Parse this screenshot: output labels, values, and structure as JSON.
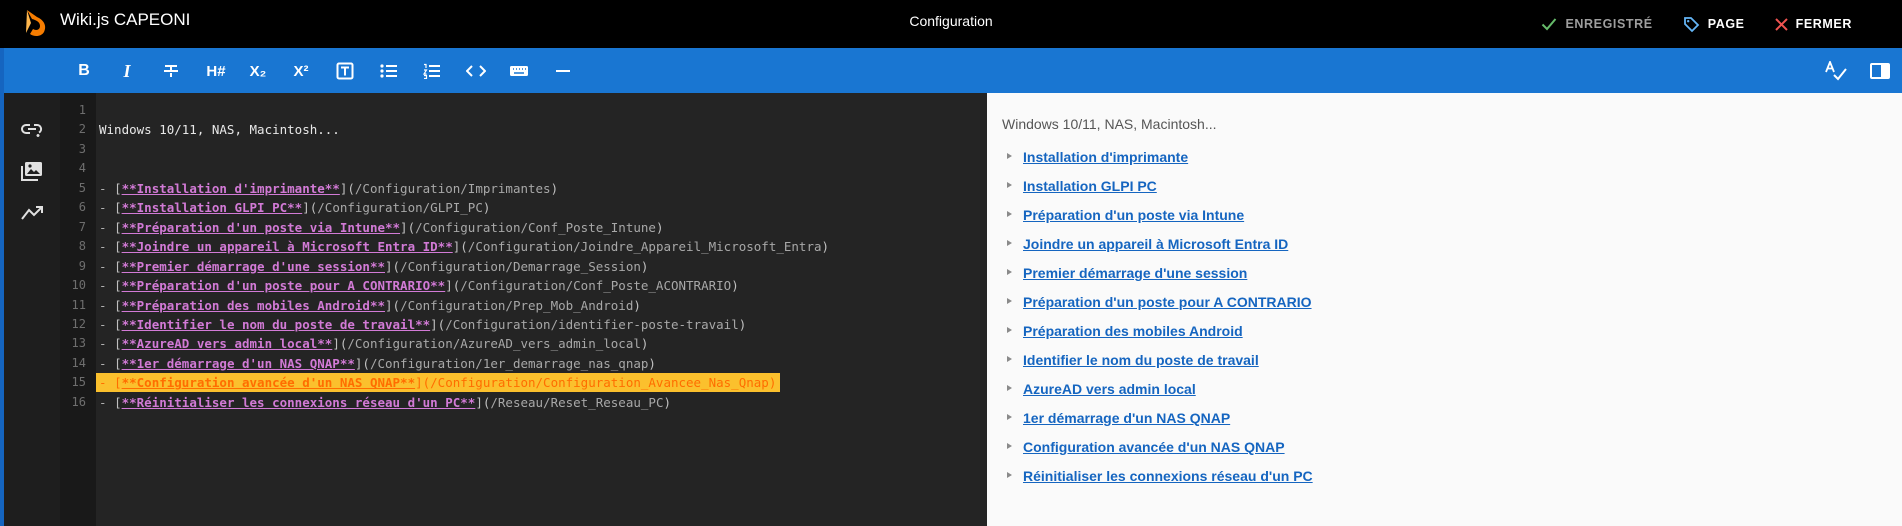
{
  "header": {
    "app_title": "Wiki.js CAPEONI",
    "page_title": "Configuration",
    "saved_label": "ENREGISTRÉ",
    "page_label": "PAGE",
    "close_label": "FERMER",
    "colors": {
      "saved": "#9e9e9e",
      "check": "#66bb6a",
      "tag": "#64b5f6",
      "close_x": "#ef5350",
      "logo": "#f57c00"
    }
  },
  "toolbar": {
    "accent": "#1976d2",
    "buttons": [
      {
        "name": "bold",
        "label": "B",
        "icon": "format-bold-icon"
      },
      {
        "name": "italic",
        "label": "I",
        "icon": "format-italic-icon"
      },
      {
        "name": "strikethrough",
        "icon": "strikethrough-icon"
      },
      {
        "name": "heading",
        "label": "H#",
        "icon": "heading-icon"
      },
      {
        "name": "subscript",
        "label": "X₂",
        "icon": "subscript-icon"
      },
      {
        "name": "superscript",
        "label": "X²",
        "icon": "superscript-icon"
      },
      {
        "name": "blockquote",
        "icon": "text-box-icon"
      },
      {
        "name": "unordered-list",
        "icon": "bullet-list-icon"
      },
      {
        "name": "ordered-list",
        "icon": "numbered-list-icon"
      },
      {
        "name": "inline-code",
        "icon": "code-icon"
      },
      {
        "name": "keyboard",
        "icon": "keyboard-icon"
      },
      {
        "name": "horizontal-rule",
        "icon": "minus-icon"
      }
    ],
    "right_buttons": [
      {
        "name": "spellcheck",
        "icon": "spellcheck-icon"
      },
      {
        "name": "toggle-preview",
        "icon": "split-panel-icon"
      }
    ]
  },
  "sidebar": {
    "buttons": [
      {
        "name": "insert-link",
        "icon": "link-plus-icon"
      },
      {
        "name": "insert-assets",
        "icon": "image-multiple-icon"
      },
      {
        "name": "insert-diagram",
        "icon": "chart-arrow-icon"
      }
    ]
  },
  "editor": {
    "lines": [
      {
        "n": "1",
        "text": ""
      },
      {
        "n": "2",
        "text": "Windows 10/11, NAS, Macintosh..."
      },
      {
        "n": "3",
        "text": ""
      },
      {
        "n": "4",
        "text": ""
      },
      {
        "n": "5",
        "link": "**Installation d'imprimante**",
        "url": "/Configuration/Imprimantes"
      },
      {
        "n": "6",
        "link": "**Installation GLPI PC**",
        "url": "/Configuration/GLPI_PC"
      },
      {
        "n": "7",
        "link": "**Préparation d'un poste via Intune**",
        "url": "/Configuration/Conf_Poste_Intune"
      },
      {
        "n": "8",
        "link": "**Joindre un appareil à Microsoft Entra ID**",
        "url": "/Configuration/Joindre_Appareil_Microsoft_Entra"
      },
      {
        "n": "9",
        "link": "**Premier démarrage d'une session**",
        "url": "/Configuration/Demarrage_Session"
      },
      {
        "n": "10",
        "link": "**Préparation d'un poste pour A CONTRARIO**",
        "url": "/Configuration/Conf_Poste_ACONTRARIO"
      },
      {
        "n": "11",
        "link": "**Préparation des mobiles Android**",
        "url": "/Configuration/Prep_Mob_Android"
      },
      {
        "n": "12",
        "link": "**Identifier le nom du poste de travail**",
        "url": "/Configuration/identifier-poste-travail"
      },
      {
        "n": "13",
        "link": "**AzureAD vers admin local**",
        "url": "/Configuration/AzureAD_vers_admin_local"
      },
      {
        "n": "14",
        "link": "**1er démarrage d'un NAS QNAP**",
        "url": "/Configuration/1er_demarrage_nas_qnap"
      },
      {
        "n": "15",
        "link": "**Configuration avancée d'un NAS QNAP**",
        "url": "/Configuration/Configuration_Avancee_Nas_Qnap",
        "highlight": true
      },
      {
        "n": "16",
        "link": "**Réinitialiser les connexions réseau d'un PC**",
        "url": "/Reseau/Reset_Reseau_PC"
      }
    ]
  },
  "preview": {
    "intro": "Windows 10/11, NAS, Macintosh...",
    "links": [
      "Installation d'imprimante",
      "Installation GLPI PC",
      "Préparation d'un poste via Intune",
      "Joindre un appareil à Microsoft Entra ID",
      "Premier démarrage d'une session",
      "Préparation d'un poste pour A CONTRARIO",
      "Préparation des mobiles Android",
      "Identifier le nom du poste de travail",
      "AzureAD vers admin local",
      "1er démarrage d'un NAS QNAP",
      "Configuration avancée d'un NAS QNAP",
      "Réinitialiser les connexions réseau d'un PC"
    ]
  }
}
